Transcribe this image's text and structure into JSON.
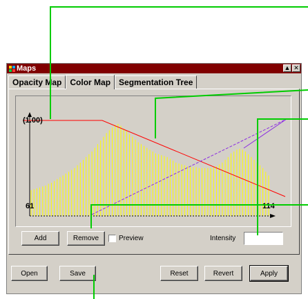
{
  "window": {
    "title": "Maps",
    "minimize_glyph": "▲",
    "close_glyph": "✕",
    "app_icon": "app-logo-icon"
  },
  "tabs": [
    {
      "label": "Opacity Map",
      "active": false
    },
    {
      "label": "Color Map",
      "active": true
    },
    {
      "label": "Segmentation Tree",
      "active": false
    }
  ],
  "graph": {
    "max_label": "(1.00)",
    "min_x_label": "61",
    "max_x_label": "114",
    "histogram_color": "#ffff00",
    "red_line_color": "#ff0000",
    "purple_line_color": "#8a2be2",
    "axis_color": "#000000",
    "histogram_heights": [
      0.28,
      0.29,
      0.3,
      0.31,
      0.32,
      0.33,
      0.35,
      0.36,
      0.38,
      0.4,
      0.42,
      0.44,
      0.46,
      0.48,
      0.5,
      0.52,
      0.55,
      0.58,
      0.61,
      0.64,
      0.67,
      0.7,
      0.74,
      0.78,
      0.82,
      0.86,
      0.9,
      0.93,
      0.96,
      0.99,
      1.0,
      0.98,
      0.95,
      0.92,
      0.89,
      0.86,
      0.83,
      0.8,
      0.78,
      0.76,
      0.74,
      0.72,
      0.7,
      0.68,
      0.67,
      0.66,
      0.65,
      0.64,
      0.62,
      0.6,
      0.58,
      0.57,
      0.56,
      0.55,
      0.54,
      0.54,
      0.53,
      0.53,
      0.52,
      0.52,
      0.52,
      0.52,
      0.52,
      0.53,
      0.54,
      0.56,
      0.58,
      0.61,
      0.64,
      0.68,
      0.7,
      0.72,
      0.73,
      0.72,
      0.7,
      0.67,
      0.64,
      0.61,
      0.58,
      0.55,
      0.52,
      0.48,
      0.44
    ]
  },
  "controls": {
    "add_label": "Add",
    "remove_label": "Remove",
    "preview_label": "Preview",
    "preview_checked": false,
    "intensity_label": "Intensity",
    "intensity_value": ""
  },
  "footer": {
    "open_label": "Open",
    "save_label": "Save",
    "reset_label": "Reset",
    "revert_label": "Revert",
    "apply_label": "Apply"
  },
  "callout_color": "#00cc00"
}
